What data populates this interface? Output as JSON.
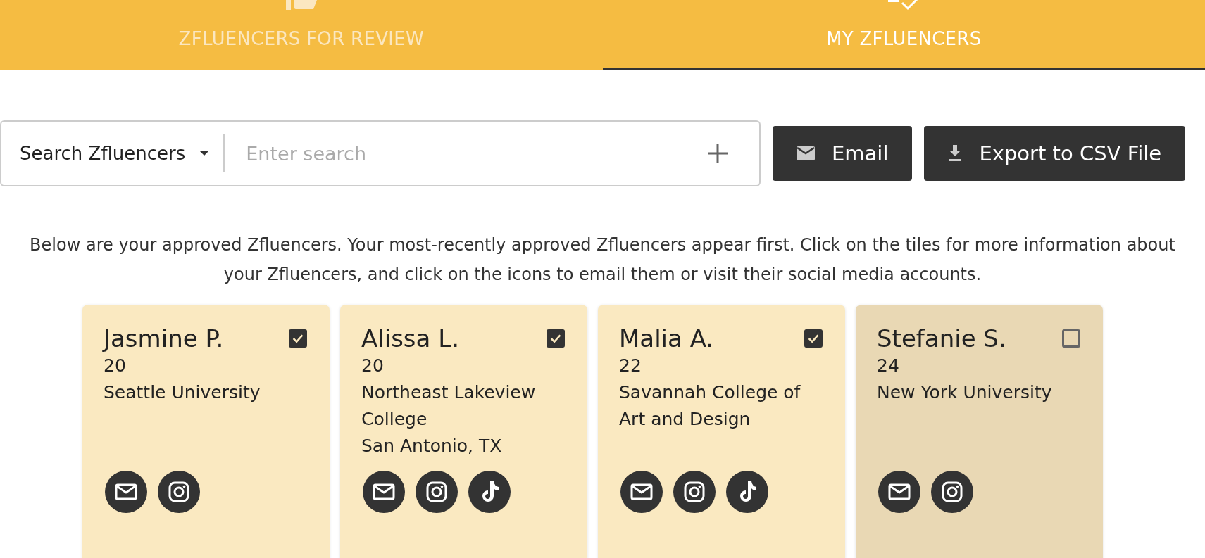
{
  "tabs": [
    {
      "label": "ZFLUENCERS FOR REVIEW",
      "kind": "review",
      "selected": false
    },
    {
      "label": "MY ZFLUENCERS",
      "kind": "mine",
      "selected": true
    }
  ],
  "search": {
    "filter": "Search Zfluencers",
    "placeholder": "Enter search"
  },
  "buttons": [
    {
      "label": "Email",
      "kind": "email"
    },
    {
      "label": "Export to CSV File",
      "kind": "download"
    }
  ],
  "description": "Below are your approved Zfluencers. Your most-recently approved Zfluencers appear first. Click on the tiles for more information about your Zfluencers, and click on the icons to email them or visit their social media accounts.",
  "cards": [
    {
      "name": "Jasmine P.",
      "age": "20",
      "school": "Seattle University",
      "selected": true,
      "links": [
        {
          "kind": "email"
        },
        {
          "kind": "instagram"
        }
      ]
    },
    {
      "name": "Alissa L.",
      "age": "20",
      "school": "Northeast Lakeview College",
      "location": "San Antonio, TX",
      "selected": true,
      "links": [
        {
          "kind": "email"
        },
        {
          "kind": "instagram"
        },
        {
          "kind": "tiktok"
        }
      ]
    },
    {
      "name": "Malia A.",
      "age": "22",
      "school": "Savannah College of Art and Design",
      "selected": true,
      "links": [
        {
          "kind": "email"
        },
        {
          "kind": "instagram"
        },
        {
          "kind": "tiktok"
        }
      ]
    },
    {
      "name": "Stefanie S.",
      "age": "24",
      "school": "New York University",
      "selected": false,
      "links": [
        {
          "kind": "email"
        },
        {
          "kind": "instagram"
        }
      ]
    }
  ]
}
